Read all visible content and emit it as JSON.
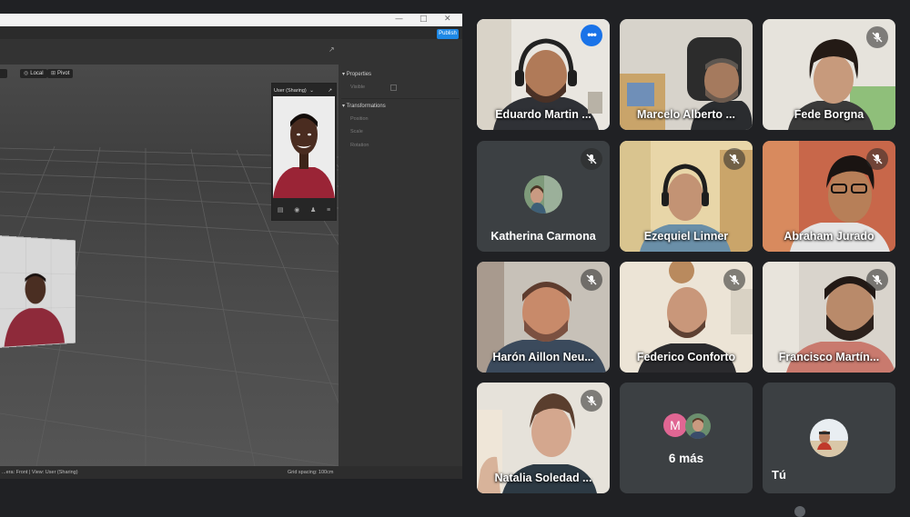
{
  "editor": {
    "publish_label": "Publish",
    "local_label": "Local",
    "pivot_label": "Pivot",
    "camera_select": "User (Sharing)",
    "properties_label": "Properties",
    "visible_label": "Visible",
    "transformations_label": "Transformations",
    "position_label": "Position",
    "scale_label": "Scale",
    "rotation_label": "Rotation",
    "status_left": "...era: Front | View: User (Sharing)",
    "status_right": "Grid spacing: 100cm"
  },
  "meeting": {
    "participants": [
      {
        "name": "Eduardo Martin ...",
        "active": true,
        "muted": false
      },
      {
        "name": "Marcelo Alberto ...",
        "muted": false
      },
      {
        "name": "Fede Borgna",
        "muted": true
      },
      {
        "name": "Katherina Carmona",
        "muted": true
      },
      {
        "name": "Ezequiel Linner",
        "muted": true
      },
      {
        "name": "Abraham Jurado",
        "muted": true
      },
      {
        "name": "Harón Aillon Neu...",
        "muted": true
      },
      {
        "name": "Federico Conforto",
        "muted": true
      },
      {
        "name": "Francisco Martín...",
        "muted": true
      },
      {
        "name": "Natalia Soledad ...",
        "muted": true
      }
    ],
    "more": {
      "initial": "M",
      "label": "6 más"
    },
    "self_label": "Tú"
  },
  "colors": {
    "accent": "#1a73e8",
    "active_border": "#8ab4f8",
    "tile_bg": "#3c4043",
    "page_bg": "#202124"
  },
  "icons": [
    "more-icon",
    "mic-off-icon",
    "camera-icon",
    "eye-icon"
  ]
}
